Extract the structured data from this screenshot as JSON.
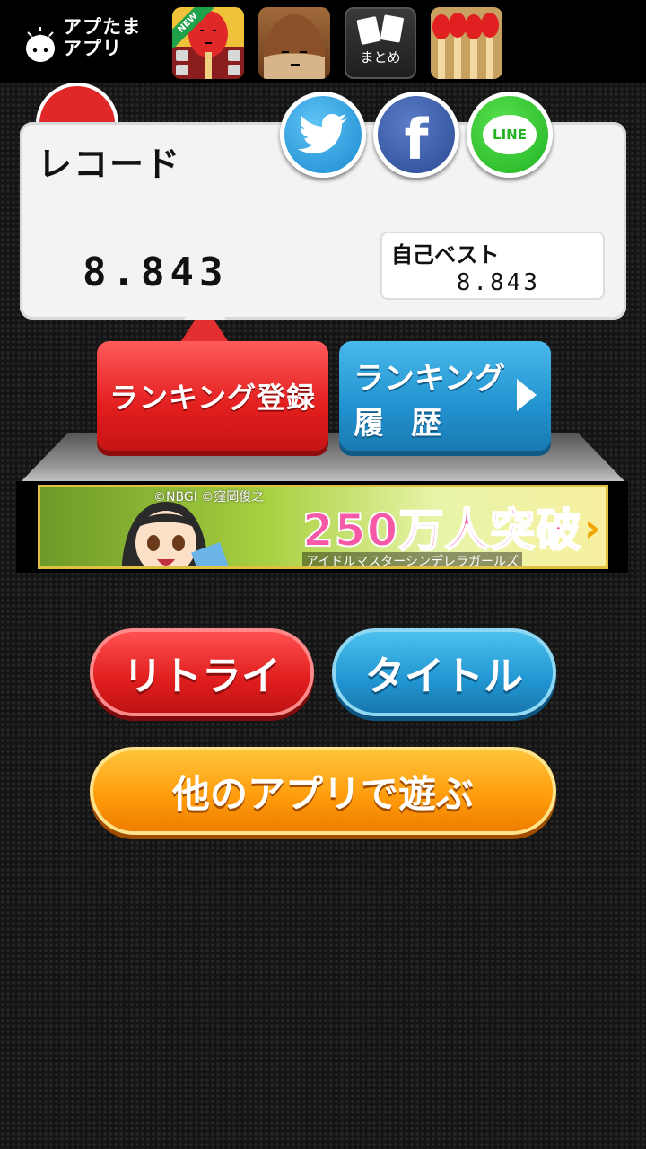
{
  "header": {
    "brand": {
      "line1": "アプたま",
      "line2": "アプリ"
    },
    "apps": [
      {
        "name": "new-app",
        "badge": "NEW"
      },
      {
        "name": "chestnut-app"
      },
      {
        "name": "summary-app",
        "label": "まとめ"
      },
      {
        "name": "matches-app"
      }
    ]
  },
  "record": {
    "title": "レコード",
    "value": "8.843",
    "best_label": "自己ベスト",
    "best_value": "8.843"
  },
  "social": {
    "twitter": "twitter-icon",
    "facebook": "f",
    "line": "LINE"
  },
  "ranking": {
    "register_label": "ランキング登録",
    "history_line1": "ランキング",
    "history_line2": "履歴"
  },
  "banner": {
    "credit": "©NBGI ©窪岡俊之",
    "headline": "250万人突破",
    "sub": "アイドルマスターシンデレラガールズ",
    "arrow": "›"
  },
  "buttons": {
    "retry": "リトライ",
    "title": "タイトル",
    "other_apps": "他のアプリで遊ぶ"
  },
  "colors": {
    "red": "#e31e1e",
    "blue": "#2292cf",
    "orange": "#ff9a0a",
    "background": "#141414"
  }
}
